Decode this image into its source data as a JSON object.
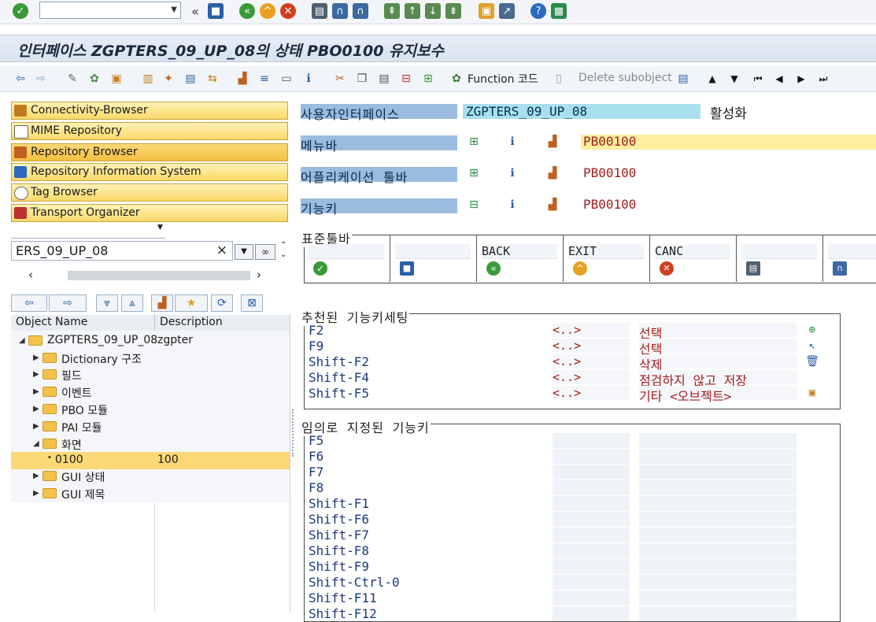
{
  "title": "인터페이스 ZGPTERS_09_UP_08의 상태 PBO0100 유지보수",
  "app_toolbar": {
    "function_code_label": "Function 코드",
    "delete_subobject_label": "Delete subobject"
  },
  "nav_buttons": [
    {
      "label": "Connectivity-Browser"
    },
    {
      "label": "MIME Repository"
    },
    {
      "label": "Repository Browser"
    },
    {
      "label": "Repository Information System"
    },
    {
      "label": "Tag Browser"
    },
    {
      "label": "Transport Organizer"
    }
  ],
  "object_input": {
    "value": "ERS_09_UP_08",
    "clear": "×"
  },
  "tree": {
    "headers": {
      "name": "Object Name",
      "description": "Description"
    },
    "rows": [
      {
        "name": "ZGPTERS_09_UP_08",
        "desc": "zgpter"
      },
      {
        "name": "Dictionary 구조",
        "desc": ""
      },
      {
        "name": "필드",
        "desc": ""
      },
      {
        "name": "이벤트",
        "desc": ""
      },
      {
        "name": "PBO 모듈",
        "desc": ""
      },
      {
        "name": "PAI 모듈",
        "desc": ""
      },
      {
        "name": "화면",
        "desc": ""
      },
      {
        "name": "0100",
        "desc": "100"
      },
      {
        "name": "GUI 상태",
        "desc": ""
      },
      {
        "name": "GUI 제목",
        "desc": ""
      }
    ]
  },
  "interface": {
    "label": "사용자인터페이스",
    "value": "ZGPTERS_09_UP_08",
    "status": "활성화"
  },
  "sections": [
    {
      "label": "메뉴바",
      "value": "PB00100"
    },
    {
      "label": "어플리케이션 툴바",
      "value": "PB00100"
    },
    {
      "label": "기능키",
      "value": "PB00100"
    }
  ],
  "standard_toolbar": {
    "title": "표준툴바",
    "cells": [
      {
        "code": ""
      },
      {
        "code": ""
      },
      {
        "code": "BACK"
      },
      {
        "code": "EXIT"
      },
      {
        "code": "CANC"
      },
      {
        "code": ""
      },
      {
        "code": ""
      }
    ]
  },
  "recommended_keys": {
    "title": "추천된 기능키세팅",
    "rows": [
      {
        "key": "F2",
        "code": "<..>",
        "text": "선택"
      },
      {
        "key": "F9",
        "code": "<..>",
        "text": "선택"
      },
      {
        "key": "Shift-F2",
        "code": "<..>",
        "text": "삭제"
      },
      {
        "key": "Shift-F4",
        "code": "<..>",
        "text": "점검하지 않고 저장"
      },
      {
        "key": "Shift-F5",
        "code": "<..>",
        "text": "기타 <오브젝트>"
      }
    ]
  },
  "free_keys": {
    "title": "임의로 지정된 기능키",
    "rows": [
      {
        "key": "F5"
      },
      {
        "key": "F6"
      },
      {
        "key": "F7"
      },
      {
        "key": "F8"
      },
      {
        "key": "Shift-F1"
      },
      {
        "key": "Shift-F6"
      },
      {
        "key": "Shift-F7"
      },
      {
        "key": "Shift-F8"
      },
      {
        "key": "Shift-F9"
      },
      {
        "key": "Shift-Ctrl-0"
      },
      {
        "key": "Shift-F11"
      },
      {
        "key": "Shift-F12"
      }
    ]
  }
}
